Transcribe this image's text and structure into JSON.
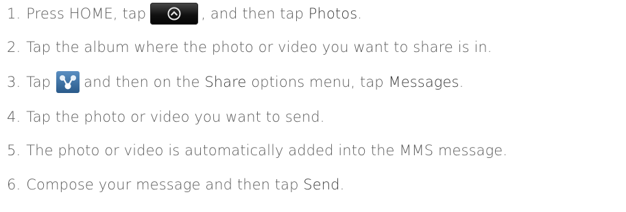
{
  "steps": [
    {
      "num": "1.",
      "parts": {
        "a": "Press HOME, tap",
        "b": ", and then tap",
        "c": "Photos",
        "d": "."
      }
    },
    {
      "num": "2.",
      "parts": {
        "a": "Tap the album where the photo or video you want to share is in."
      }
    },
    {
      "num": "3.",
      "parts": {
        "a": "Tap",
        "b": "and then on the",
        "c": "Share",
        "d": "options menu, tap",
        "e": "Messages",
        "f": "."
      }
    },
    {
      "num": "4.",
      "parts": {
        "a": "Tap the photo or video you want to send."
      }
    },
    {
      "num": "5.",
      "parts": {
        "a": "The photo or video is automatically added into the MMS message."
      }
    },
    {
      "num": "6.",
      "parts": {
        "a": "Compose your message and then tap",
        "b": "Send",
        "c": "."
      }
    }
  ],
  "icons": {
    "home_button": "all-apps-button-icon",
    "share": "share-icon"
  },
  "colors": {
    "text": "#5c5c5c",
    "keyword": "#3a3a3a"
  }
}
